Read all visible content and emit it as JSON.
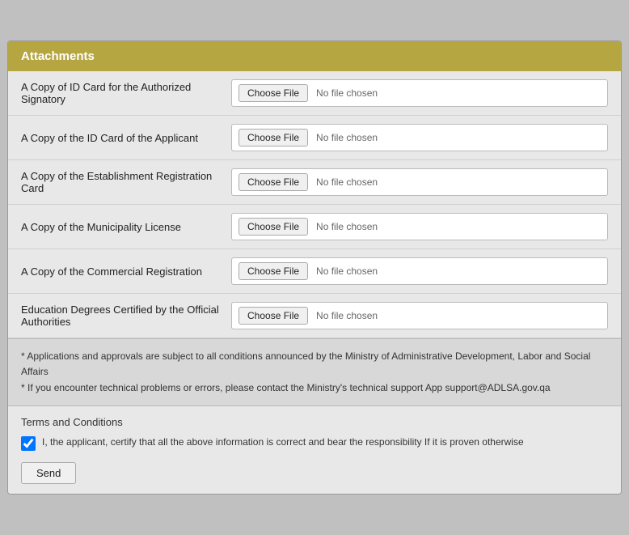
{
  "header": {
    "title": "Attachments"
  },
  "attachments": [
    {
      "id": "id-card-signatory",
      "label": "A Copy of ID Card for the Authorized Signatory",
      "button": "Choose File",
      "placeholder": "No file chosen"
    },
    {
      "id": "id-card-applicant",
      "label": "A Copy of the ID Card of the Applicant",
      "button": "Choose File",
      "placeholder": "No file chosen"
    },
    {
      "id": "establishment-registration",
      "label": "A Copy of the Establishment Registration Card",
      "button": "Choose File",
      "placeholder": "No file chosen"
    },
    {
      "id": "municipality-license",
      "label": "A Copy of the Municipality License",
      "button": "Choose File",
      "placeholder": "No file chosen"
    },
    {
      "id": "commercial-registration",
      "label": "A Copy of the Commercial Registration",
      "button": "Choose File",
      "placeholder": "No file chosen"
    },
    {
      "id": "education-degrees",
      "label": "Education Degrees Certified by the Official Authorities",
      "button": "Choose File",
      "placeholder": "No file chosen"
    }
  ],
  "notice": {
    "line1": "* Applications and approvals are subject to all conditions announced by the Ministry of Administrative Development, Labor and Social Affairs",
    "line2": "* If you encounter technical problems or errors, please contact the Ministry's technical support App support@ADLSA.gov.qa"
  },
  "terms": {
    "title": "Terms and Conditions",
    "checkbox_label": "I, the applicant, certify that all the above information is correct and bear the responsibility If it is proven otherwise",
    "checked": true
  },
  "send_button": "Send"
}
